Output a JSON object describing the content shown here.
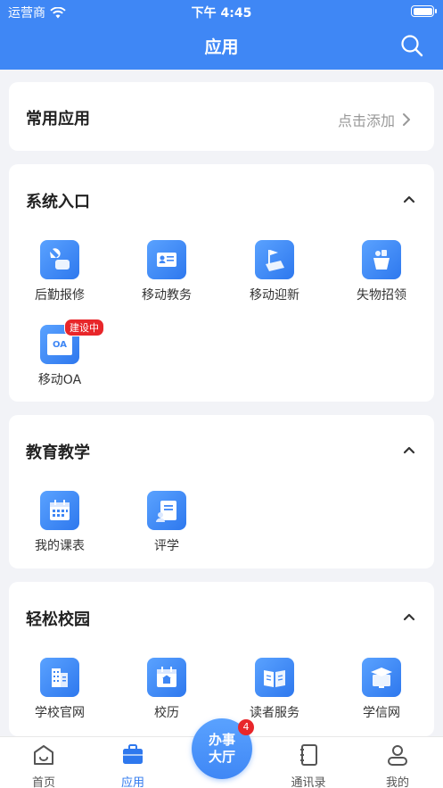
{
  "status_bar": {
    "carrier": "运营商",
    "time": "下午 4:45"
  },
  "nav": {
    "title": "应用"
  },
  "favorites": {
    "title": "常用应用",
    "action": "点击添加"
  },
  "sections": [
    {
      "title": "系统入口",
      "apps": [
        {
          "label": "后勤报修",
          "icon": "repair-icon"
        },
        {
          "label": "移动教务",
          "icon": "id-card-icon"
        },
        {
          "label": "移动迎新",
          "icon": "flag-icon"
        },
        {
          "label": "失物招领",
          "icon": "lost-found-icon"
        },
        {
          "label": "移动OA",
          "icon": "oa-icon",
          "badge": "建设中",
          "icon_text": "OA"
        }
      ]
    },
    {
      "title": "教育教学",
      "apps": [
        {
          "label": "我的课表",
          "icon": "calendar-icon"
        },
        {
          "label": "评学",
          "icon": "evaluation-icon"
        }
      ]
    },
    {
      "title": "轻松校园",
      "apps": [
        {
          "label": "学校官网",
          "icon": "building-icon"
        },
        {
          "label": "校历",
          "icon": "school-calendar-icon"
        },
        {
          "label": "读者服务",
          "icon": "book-icon"
        },
        {
          "label": "学信网",
          "icon": "graduation-icon"
        }
      ]
    }
  ],
  "tab_bar": {
    "tabs": [
      {
        "label": "首页"
      },
      {
        "label": "应用"
      },
      {
        "label": "通讯录"
      },
      {
        "label": "我的"
      }
    ],
    "center": {
      "label": "办事大厅",
      "line1": "办事",
      "line2": "大厅",
      "badge": "4"
    }
  },
  "colors": {
    "primary": "#3f87f5",
    "badge": "#e8262a",
    "background": "#f2f3f7"
  }
}
